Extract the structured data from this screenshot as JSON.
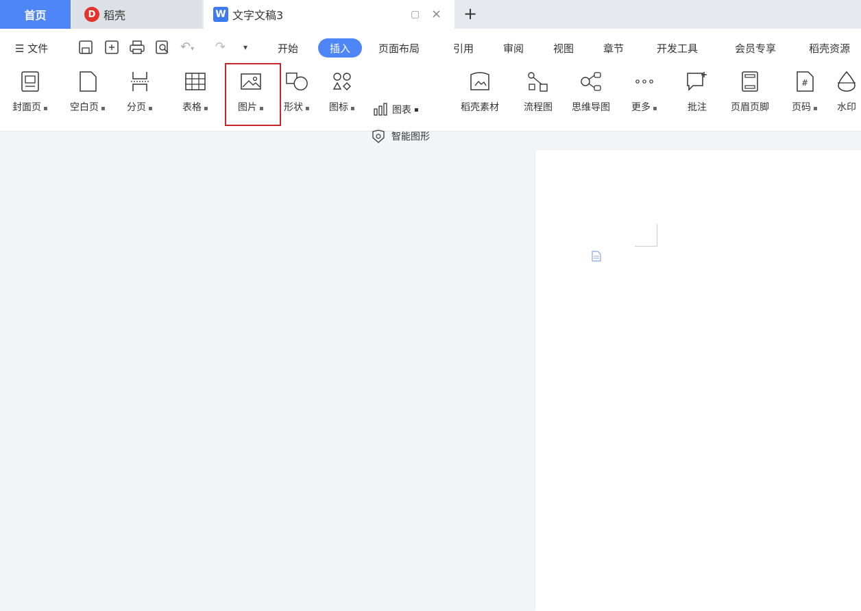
{
  "tabbar": {
    "home": "首页",
    "docer": "稻壳",
    "doc": "文字文稿3",
    "add": "+"
  },
  "menu": {
    "file": "文件",
    "tabs": [
      "开始",
      "插入",
      "页面布局",
      "引用",
      "审阅",
      "视图",
      "章节",
      "开发工具",
      "会员专享",
      "稻壳资源"
    ],
    "active": "插入"
  },
  "tools": {
    "cover": "封面页",
    "blank": "空白页",
    "pagebreak": "分页",
    "table": "表格",
    "picture": "图片",
    "shape": "形状",
    "icon": "图标",
    "chart": "图表",
    "smart": "智能图形",
    "material": "稻壳素材",
    "flow": "流程图",
    "mind": "思维导图",
    "more": "更多",
    "comment": "批注",
    "header": "页眉页脚",
    "pagenum": "页码",
    "watermark": "水印"
  },
  "colors": {
    "accent": "#4f86f7",
    "highlight": "#c8242b"
  }
}
